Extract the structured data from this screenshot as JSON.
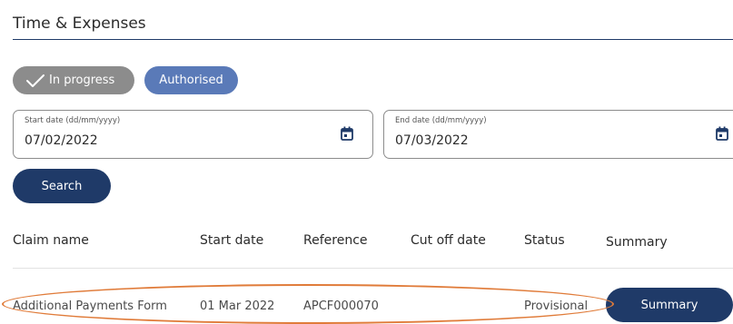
{
  "page": {
    "title": "Time & Expenses"
  },
  "filters": {
    "chips": [
      {
        "label": "In progress",
        "selected": true,
        "icon": "check-icon"
      },
      {
        "label": "Authorised",
        "selected": false
      }
    ]
  },
  "start_date": {
    "label": "Start date (dd/mm/yyyy)",
    "value": "07/02/2022",
    "icon": "calendar-icon"
  },
  "end_date": {
    "label": "End date (dd/mm/yyyy)",
    "value": "07/03/2022",
    "icon": "calendar-icon"
  },
  "search": {
    "label": "Search"
  },
  "table": {
    "columns": [
      "Claim name",
      "Start date",
      "Reference",
      "Cut off date",
      "Status",
      "Summary"
    ],
    "rows": [
      {
        "claim_name": "Additional Payments Form",
        "start_date": "01 Mar 2022",
        "reference": "APCF000070",
        "cut_off_date": "",
        "status": "Provisional",
        "action_label": "Summary"
      }
    ]
  },
  "colors": {
    "primary": "#1f3a68",
    "chip_selected": "#8c8c8c",
    "chip_authorised": "#5a7ab8",
    "highlight": "#e07b39"
  }
}
